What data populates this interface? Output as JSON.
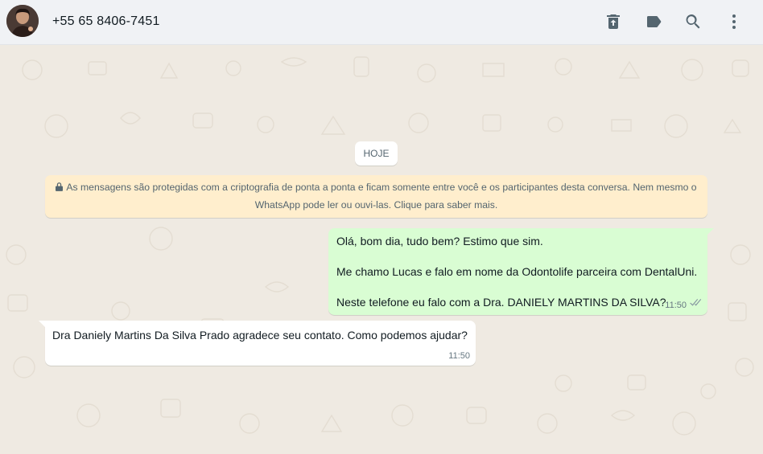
{
  "header": {
    "contact_name": "+55 65 8406-7451",
    "icons": [
      "delete-icon",
      "label-icon",
      "search-icon",
      "menu-icon"
    ]
  },
  "chat": {
    "date_divider": "HOJE",
    "encryption_notice": "As mensagens são protegidas com a criptografia de ponta a ponta e ficam somente entre você e os participantes desta conversa. Nem mesmo o WhatsApp pode ler ou ouvi-las. Clique para saber mais.",
    "messages": [
      {
        "direction": "outgoing",
        "lines": [
          "Olá, bom dia, tudo bem? Estimo que sim.",
          "Me chamo Lucas e falo em nome da Odontolife parceira com DentalUni.",
          "Neste telefone eu falo com a Dra.  DANIELY MARTINS DA SILVA?"
        ],
        "time": "11:50",
        "status": "read"
      },
      {
        "direction": "incoming",
        "text": "Dra Daniely Martins Da Silva Prado agradece seu contato. Como podemos ajudar?",
        "time": "11:50"
      }
    ]
  },
  "colors": {
    "header_bg": "#f0f2f5",
    "chat_bg": "#efeae2",
    "outgoing_bubble": "#d9fdd3",
    "incoming_bubble": "#ffffff",
    "notice_bg": "#ffeecd"
  }
}
